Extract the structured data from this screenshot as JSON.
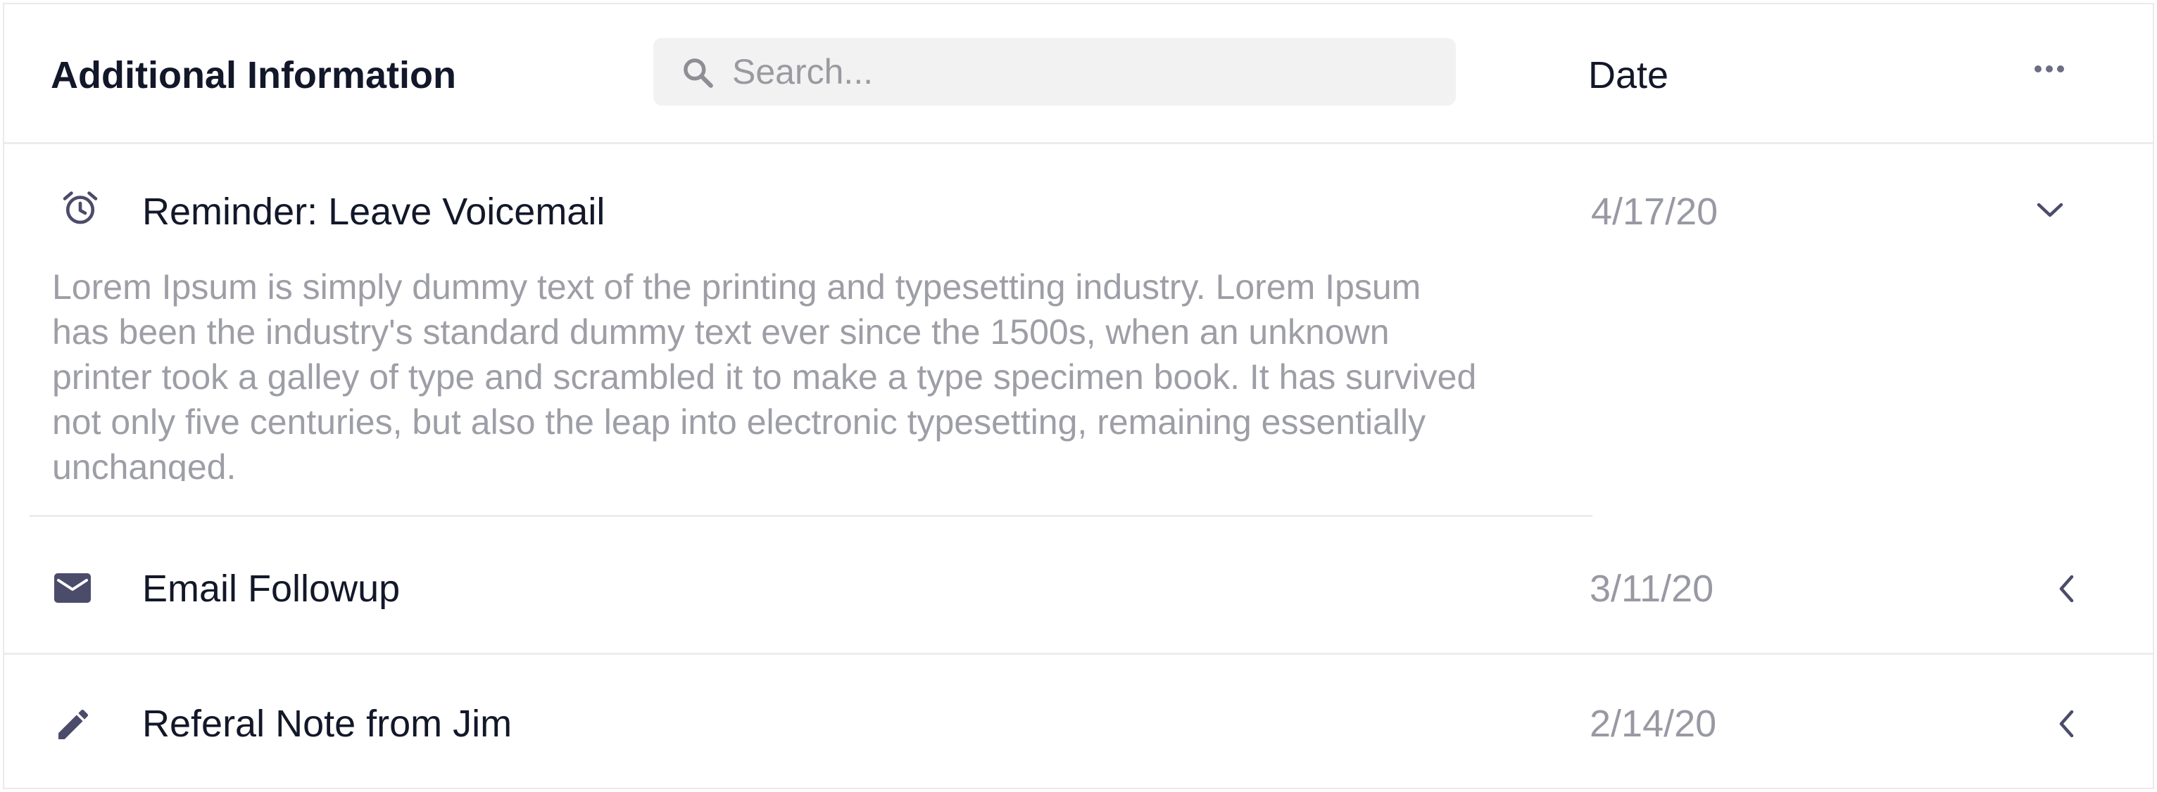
{
  "header": {
    "title": "Additional Information",
    "search_placeholder": "Search...",
    "date_label": "Date"
  },
  "items": [
    {
      "title": "Reminder: Leave Voicemail",
      "date": "4/17/20",
      "icon": "alarm-clock-icon",
      "expanded": true,
      "body": "Lorem Ipsum is simply dummy text of the printing and typesetting industry. Lorem Ipsum has been the industry's standard dummy text ever since the 1500s, when an unknown printer took a galley of type and scrambled it to make a type specimen book. It has survived not only five centuries, but also the leap into electronic typesetting, remaining essentially unchanged."
    },
    {
      "title": "Email Followup",
      "date": "3/11/20",
      "icon": "envelope-icon",
      "expanded": false
    },
    {
      "title": "Referal Note from Jim",
      "date": "2/14/20",
      "icon": "pencil-icon",
      "expanded": false
    }
  ],
  "colors": {
    "text_primary": "#121829",
    "text_muted": "#9899a3",
    "icon": "#4b4c6a",
    "search_bg": "#f2f2f3",
    "divider": "#ececef"
  }
}
